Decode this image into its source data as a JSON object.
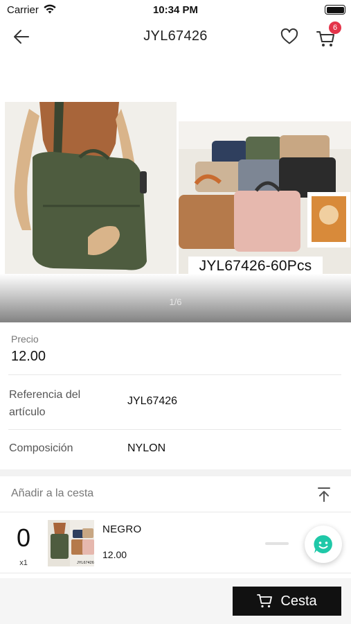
{
  "status_bar": {
    "carrier": "Carrier",
    "time": "10:34 PM"
  },
  "navbar": {
    "title": "JYL67426",
    "cart_count": "6"
  },
  "gallery": {
    "caption": "JYL67426-60Pcs",
    "page_indicator": "1/6"
  },
  "details": {
    "price_label": "Precio",
    "price_value": "12.00",
    "reference_label": "Referencia del artículo",
    "reference_value": "JYL67426",
    "composition_label": "Composición",
    "composition_value": "NYLON"
  },
  "add_to_cart": {
    "header": "Añadir a la cesta",
    "variant": {
      "quantity": "0",
      "unit": "x1",
      "name": "NEGRO",
      "price": "12.00",
      "thumb_text": "JYL67426"
    }
  },
  "bottom_bar": {
    "cesta_label": "Cesta"
  },
  "colors": {
    "badge": "#e4344a",
    "chat_icon": "#1fc8a8",
    "primary_button": "#111111"
  },
  "icons": [
    "wifi-icon",
    "battery-icon",
    "back-arrow-icon",
    "heart-icon",
    "cart-icon",
    "scroll-top-icon",
    "chat-icon",
    "basket-icon"
  ]
}
